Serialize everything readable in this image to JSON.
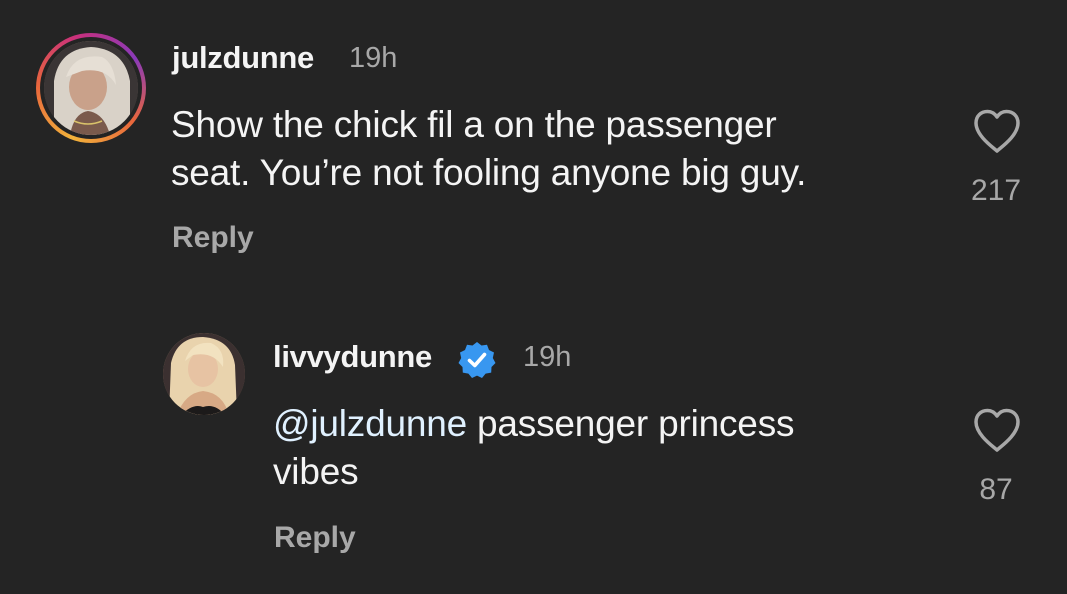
{
  "comments": [
    {
      "username": "julzdunne",
      "time": "19h",
      "text": "Show the chick fil a on the passenger seat. You’re not fooling anyone big guy.",
      "text_line1": "Show the chick fil a on the passenger",
      "text_line2": "seat. You’re not fooling anyone big guy.",
      "reply_label": "Reply",
      "likes": "217",
      "avatar_icon": "profile-photo",
      "heart_icon": "heart-outline-icon"
    },
    {
      "username": "livvydunne",
      "verified": true,
      "verified_icon": "verified-badge-icon",
      "time": "19h",
      "mention": "@julzdunne",
      "text_rest": " passenger princess",
      "text_line2": "vibes",
      "reply_label": "Reply",
      "likes": "87",
      "avatar_icon": "profile-photo",
      "heart_icon": "heart-outline-icon"
    }
  ],
  "colors": {
    "background": "#242424",
    "text_primary": "#f4f4f4",
    "text_secondary": "#a8a8a8",
    "verified": "#3897f0"
  }
}
